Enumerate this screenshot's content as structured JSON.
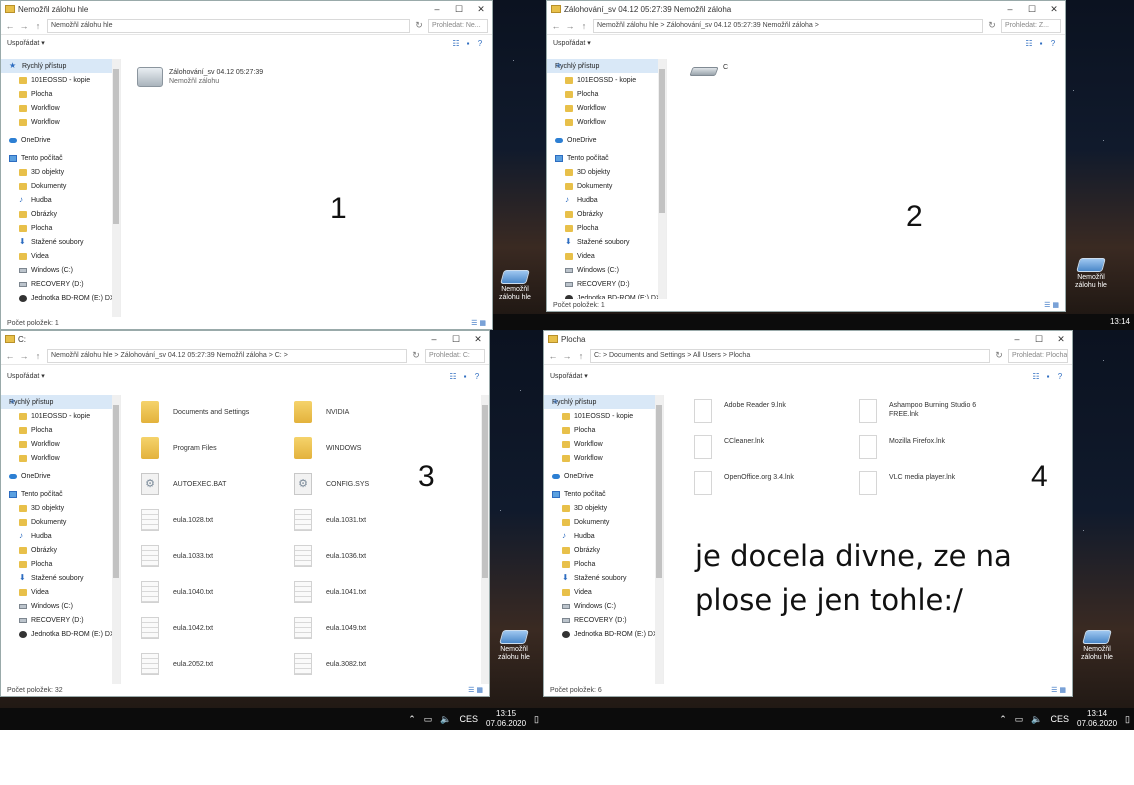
{
  "q1": {
    "title": "Nemožňl zálohu hle",
    "toolbar_label": "Uspořádat ▾",
    "search": "Prohledat: Ne...",
    "sidebar": [
      {
        "label": "Rychlý přístup",
        "icon": "star",
        "sel": true
      },
      {
        "label": "101EOSSD - kopie",
        "icon": "folder",
        "sub": true
      },
      {
        "label": "Plocha",
        "icon": "folder",
        "sub": true
      },
      {
        "label": "Workflow",
        "icon": "folder",
        "sub": true
      },
      {
        "label": "Workflow",
        "icon": "folder",
        "sub": true
      },
      {
        "label": "OneDrive",
        "icon": "cloud",
        "gap": true
      },
      {
        "label": "Tento počítač",
        "icon": "pc",
        "gap": true
      },
      {
        "label": "3D objekty",
        "icon": "folder",
        "sub": true
      },
      {
        "label": "Dokumenty",
        "icon": "folder",
        "sub": true
      },
      {
        "label": "Hudba",
        "icon": "music",
        "sub": true
      },
      {
        "label": "Obrázky",
        "icon": "folder",
        "sub": true
      },
      {
        "label": "Plocha",
        "icon": "folder",
        "sub": true
      },
      {
        "label": "Stažené soubory",
        "icon": "down",
        "sub": true
      },
      {
        "label": "Videa",
        "icon": "folder",
        "sub": true
      },
      {
        "label": "Windows (C:)",
        "icon": "drive",
        "sub": true
      },
      {
        "label": "RECOVERY (D:)",
        "icon": "drive",
        "sub": true
      },
      {
        "label": "Jednotka BD-ROM (E:) DX",
        "icon": "disc",
        "sub": true
      }
    ],
    "item_name": "Zálohování_sv 04.12 05:27:39",
    "item_sub": "Nemožňl zálohu",
    "status": "Počet položek: 1",
    "number": "1"
  },
  "q2": {
    "title": "Zálohování_sv 04.12 05:27:39 Nemožňl záloha",
    "path": "Nemožňl zálohu hle  >  Zálohování_sv 04.12 05:27:39 Nemožňl záloha  >",
    "toolbar_label": "Uspořádat ▾",
    "search": "Prohledat: Z...",
    "sidebar": [
      {
        "label": "Rychlý přístup",
        "icon": "star",
        "sel": true
      },
      {
        "label": "101EOSSD - kopie",
        "icon": "folder",
        "sub": true
      },
      {
        "label": "Plocha",
        "icon": "folder",
        "sub": true
      },
      {
        "label": "Workflow",
        "icon": "folder",
        "sub": true
      },
      {
        "label": "Workflow",
        "icon": "folder",
        "sub": true
      },
      {
        "label": "OneDrive",
        "icon": "cloud",
        "gap": true
      },
      {
        "label": "Tento počítač",
        "icon": "pc",
        "gap": true
      },
      {
        "label": "3D objekty",
        "icon": "folder",
        "sub": true
      },
      {
        "label": "Dokumenty",
        "icon": "folder",
        "sub": true
      },
      {
        "label": "Hudba",
        "icon": "music",
        "sub": true
      },
      {
        "label": "Obrázky",
        "icon": "folder",
        "sub": true
      },
      {
        "label": "Plocha",
        "icon": "folder",
        "sub": true
      },
      {
        "label": "Stažené soubory",
        "icon": "down",
        "sub": true
      },
      {
        "label": "Videa",
        "icon": "folder",
        "sub": true
      },
      {
        "label": "Windows (C:)",
        "icon": "drive",
        "sub": true
      },
      {
        "label": "RECOVERY (D:)",
        "icon": "drive",
        "sub": true
      },
      {
        "label": "Jednotka BD-ROM (E:) DX",
        "icon": "disc",
        "sub": true
      }
    ],
    "item_name": "C",
    "status": "Počet položek: 1",
    "number": "2",
    "desk_icon": "Nemožňl zálohu hle",
    "clock_time": "13:14"
  },
  "q3": {
    "title": "C:",
    "path": "Nemožňl zálohu hle  >  Zálohování_sv 04.12 05:27:39 Nemožňl záloha  >  C:  >",
    "toolbar_label": "Uspořádat ▾",
    "search": "Prohledat: C:",
    "sidebar": [
      {
        "label": "Rychlý přístup",
        "icon": "star",
        "sel": true
      },
      {
        "label": "101EOSSD - kopie",
        "icon": "folder",
        "sub": true
      },
      {
        "label": "Plocha",
        "icon": "folder",
        "sub": true
      },
      {
        "label": "Workflow",
        "icon": "folder",
        "sub": true
      },
      {
        "label": "Workflow",
        "icon": "folder",
        "sub": true
      },
      {
        "label": "OneDrive",
        "icon": "cloud",
        "gap": true
      },
      {
        "label": "Tento počítač",
        "icon": "pc",
        "gap": true
      },
      {
        "label": "3D objekty",
        "icon": "folder",
        "sub": true
      },
      {
        "label": "Dokumenty",
        "icon": "folder",
        "sub": true
      },
      {
        "label": "Hudba",
        "icon": "music",
        "sub": true
      },
      {
        "label": "Obrázky",
        "icon": "folder",
        "sub": true
      },
      {
        "label": "Plocha",
        "icon": "folder",
        "sub": true
      },
      {
        "label": "Stažené soubory",
        "icon": "down",
        "sub": true
      },
      {
        "label": "Videa",
        "icon": "folder",
        "sub": true
      },
      {
        "label": "Windows (C:)",
        "icon": "drive",
        "sub": true
      },
      {
        "label": "RECOVERY (D:)",
        "icon": "drive",
        "sub": true
      },
      {
        "label": "Jednotka BD-ROM (E:) DX",
        "icon": "disc",
        "sub": true
      }
    ],
    "files": [
      {
        "name": "Documents and Settings",
        "kind": "folder"
      },
      {
        "name": "NVIDIA",
        "kind": "folder"
      },
      {
        "name": "Program Files",
        "kind": "folder"
      },
      {
        "name": "WINDOWS",
        "kind": "folder"
      },
      {
        "name": "AUTOEXEC.BAT",
        "kind": "gear"
      },
      {
        "name": "CONFIG.SYS",
        "kind": "gear"
      },
      {
        "name": "eula.1028.txt",
        "kind": "txt"
      },
      {
        "name": "eula.1031.txt",
        "kind": "txt"
      },
      {
        "name": "eula.1033.txt",
        "kind": "txt"
      },
      {
        "name": "eula.1036.txt",
        "kind": "txt"
      },
      {
        "name": "eula.1040.txt",
        "kind": "txt"
      },
      {
        "name": "eula.1041.txt",
        "kind": "txt"
      },
      {
        "name": "eula.1042.txt",
        "kind": "txt"
      },
      {
        "name": "eula.1049.txt",
        "kind": "txt"
      },
      {
        "name": "eula.2052.txt",
        "kind": "txt"
      },
      {
        "name": "eula.3082.txt",
        "kind": "txt"
      }
    ],
    "status": "Počet položek: 32",
    "number": "3",
    "desk_icon": "Nemožňl zálohu hle",
    "clock_time": "13:15",
    "clock_date": "07.06.2020",
    "lang": "CES"
  },
  "q4": {
    "title": "Plocha",
    "path": "C:  >  Documents and Settings  >  All Users  >  Plocha",
    "toolbar_label": "Uspořádat ▾",
    "search": "Prohledat: Plocha",
    "sidebar": [
      {
        "label": "Rychlý přístup",
        "icon": "star",
        "sel": true
      },
      {
        "label": "101EOSSD - kopie",
        "icon": "folder",
        "sub": true
      },
      {
        "label": "Plocha",
        "icon": "folder",
        "sub": true
      },
      {
        "label": "Workflow",
        "icon": "folder",
        "sub": true
      },
      {
        "label": "Workflow",
        "icon": "folder",
        "sub": true
      },
      {
        "label": "OneDrive",
        "icon": "cloud",
        "gap": true
      },
      {
        "label": "Tento počítač",
        "icon": "pc",
        "gap": true
      },
      {
        "label": "3D objekty",
        "icon": "folder",
        "sub": true
      },
      {
        "label": "Dokumenty",
        "icon": "folder",
        "sub": true
      },
      {
        "label": "Hudba",
        "icon": "music",
        "sub": true
      },
      {
        "label": "Obrázky",
        "icon": "folder",
        "sub": true
      },
      {
        "label": "Plocha",
        "icon": "folder",
        "sub": true
      },
      {
        "label": "Stažené soubory",
        "icon": "down",
        "sub": true
      },
      {
        "label": "Videa",
        "icon": "folder",
        "sub": true
      },
      {
        "label": "Windows (C:)",
        "icon": "drive",
        "sub": true
      },
      {
        "label": "RECOVERY (D:)",
        "icon": "drive",
        "sub": true
      },
      {
        "label": "Jednotka BD-ROM (E:) DX",
        "icon": "disc",
        "sub": true
      }
    ],
    "files": [
      {
        "name": "Adobe Reader 9.lnk"
      },
      {
        "name": "Ashampoo Burning Studio 6 FREE.lnk"
      },
      {
        "name": "CCleaner.lnk"
      },
      {
        "name": "Mozilla Firefox.lnk"
      },
      {
        "name": "OpenOffice.org 3.4.lnk"
      },
      {
        "name": "VLC media player.lnk"
      }
    ],
    "status": "Počet položek: 6",
    "number": "4",
    "comment_line1": "je docela divne, ze na",
    "comment_line2": "plose je jen tohle:/",
    "desk_icon": "Nemožňl zálohu hle",
    "clock_time": "13:14",
    "clock_date": "07.06.2020",
    "lang": "CES"
  }
}
